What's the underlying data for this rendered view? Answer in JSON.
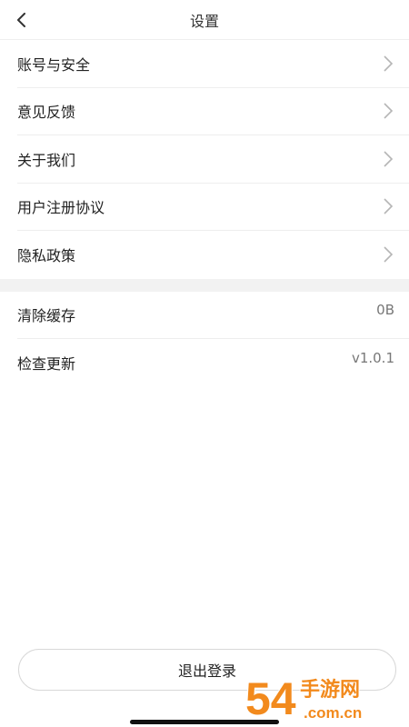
{
  "header": {
    "title": "设置"
  },
  "group1": [
    {
      "label": "账号与安全"
    },
    {
      "label": "意见反馈"
    },
    {
      "label": "关于我们"
    },
    {
      "label": "用户注册协议"
    },
    {
      "label": "隐私政策"
    }
  ],
  "group2": [
    {
      "label": "清除缓存",
      "value": "0B"
    },
    {
      "label": "检查更新",
      "value": "v1.0.1"
    }
  ],
  "logout": {
    "label": "退出登录"
  },
  "watermark": {
    "brand": "54",
    "cn": "手游网",
    "domain": ".com.cn"
  },
  "colors": {
    "divider": "#eeeeee",
    "section_gap": "#f2f2f2",
    "watermark_orange": "#f28a1d"
  }
}
